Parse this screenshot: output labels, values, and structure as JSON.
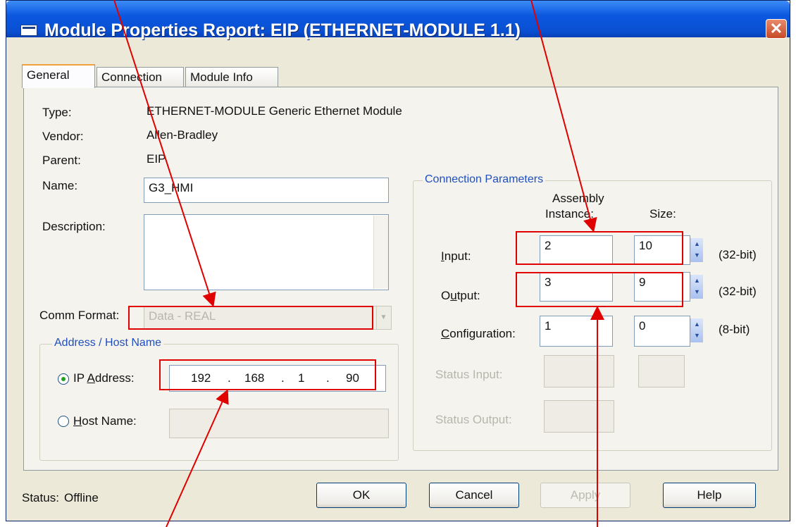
{
  "window": {
    "title": "Module Properties Report: EIP (ETHERNET-MODULE 1.1)",
    "close_glyph": "✕"
  },
  "tabs": [
    {
      "label": "General",
      "active": true
    },
    {
      "label": "Connection",
      "active": false
    },
    {
      "label": "Module Info",
      "active": false
    }
  ],
  "general": {
    "type_label": "Type:",
    "type_value": "ETHERNET-MODULE Generic Ethernet Module",
    "vendor_label": "Vendor:",
    "vendor_value": "Allen-Bradley",
    "parent_label": "Parent:",
    "parent_value": "EIP",
    "name_label": "Name:",
    "name_value": "G3_HMI",
    "description_label": "Description:",
    "description_value": "",
    "comm_format_label": "Comm Format:",
    "comm_format_value": "Data - REAL"
  },
  "address": {
    "group_title": "Address / Host Name",
    "ip_label": "IP Address:",
    "ip_octets": [
      "192",
      "168",
      "1",
      "90"
    ],
    "ip_dot": ".",
    "host_label": "Host Name:",
    "host_value": "",
    "selected": "ip"
  },
  "connection": {
    "group_title": "Connection Parameters",
    "col_assembly_line1": "Assembly",
    "col_assembly_line2": "Instance:",
    "col_size": "Size:",
    "rows": [
      {
        "label": "Input:",
        "instance": "2",
        "size": "10",
        "unit": "(32-bit)",
        "enabled": true
      },
      {
        "label": "Output:",
        "instance": "3",
        "size": "9",
        "unit": "(32-bit)",
        "enabled": true
      },
      {
        "label": "Configuration:",
        "instance": "1",
        "size": "0",
        "unit": "(8-bit)",
        "enabled": true
      },
      {
        "label": "Status Input:",
        "instance": "",
        "size": "",
        "unit": "",
        "enabled": false
      },
      {
        "label": "Status Output:",
        "instance": "",
        "size": "",
        "unit": "",
        "enabled": false
      }
    ]
  },
  "footer": {
    "status_label": "Status:",
    "status_value": "Offline",
    "ok": "OK",
    "cancel": "Cancel",
    "apply": "Apply",
    "help": "Help"
  },
  "annotation": {
    "highlight_color": "#e00000"
  }
}
